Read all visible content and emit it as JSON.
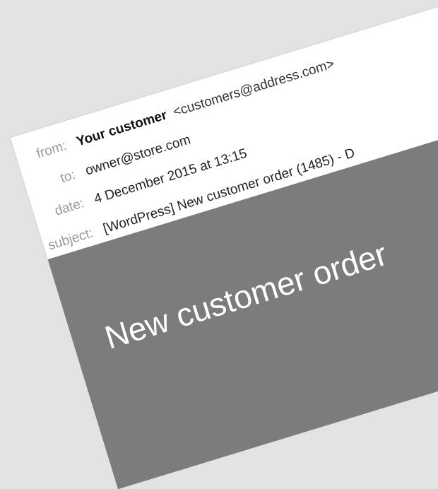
{
  "email": {
    "from_label": "from:",
    "sender_name": "Your customer",
    "sender_email": "<customers@address.com>",
    "to_label": "to:",
    "to_value": "owner@store.com",
    "date_label": "date:",
    "date_value": "4 December 2015 at 13:15",
    "subject_label": "subject:",
    "subject_value": "[WordPress] New customer order (1485) - D"
  },
  "banner": {
    "title": "New customer order"
  }
}
